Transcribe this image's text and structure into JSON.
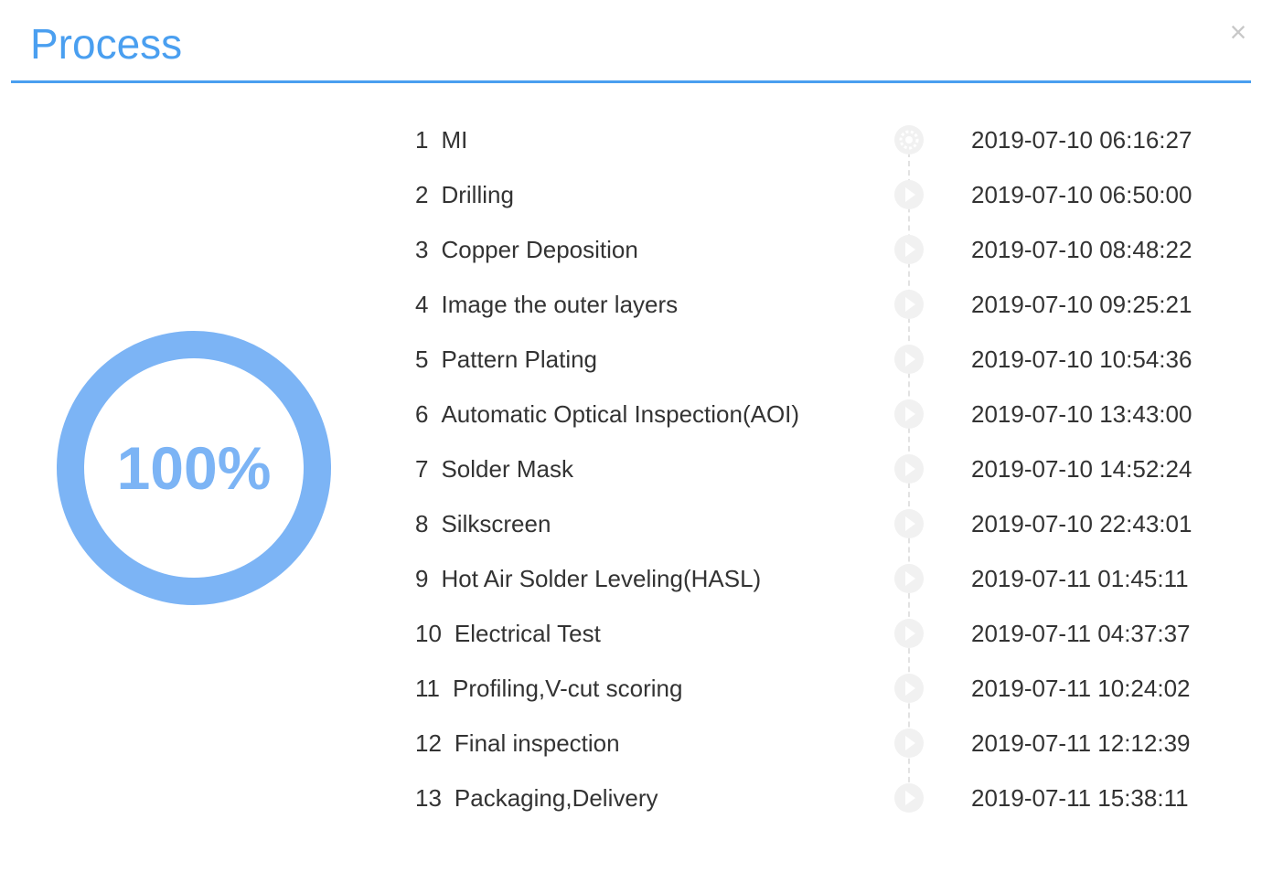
{
  "dialog": {
    "title": "Process",
    "close_label": "×"
  },
  "progress": {
    "label": "100%",
    "value_percent": 100,
    "ring_color": "#7cb4f5",
    "accent_color": "#4a9ff0"
  },
  "steps": [
    {
      "num": "1",
      "name": "MI",
      "time": "2019-07-10 06:16:27",
      "icon": "gear-icon"
    },
    {
      "num": "2",
      "name": "Drilling",
      "time": "2019-07-10 06:50:00",
      "icon": "play-icon"
    },
    {
      "num": "3",
      "name": "Copper Deposition",
      "time": "2019-07-10 08:48:22",
      "icon": "play-icon"
    },
    {
      "num": "4",
      "name": "Image the outer layers",
      "time": "2019-07-10 09:25:21",
      "icon": "play-icon"
    },
    {
      "num": "5",
      "name": "Pattern Plating",
      "time": "2019-07-10 10:54:36",
      "icon": "play-icon"
    },
    {
      "num": "6",
      "name": "Automatic Optical Inspection(AOI)",
      "time": "2019-07-10 13:43:00",
      "icon": "play-icon"
    },
    {
      "num": "7",
      "name": "Solder Mask",
      "time": "2019-07-10 14:52:24",
      "icon": "play-icon"
    },
    {
      "num": "8",
      "name": "Silkscreen",
      "time": "2019-07-10 22:43:01",
      "icon": "play-icon"
    },
    {
      "num": "9",
      "name": "Hot Air Solder Leveling(HASL)",
      "time": "2019-07-11 01:45:11",
      "icon": "play-icon"
    },
    {
      "num": "10",
      "name": "Electrical Test",
      "time": "2019-07-11 04:37:37",
      "icon": "play-icon"
    },
    {
      "num": "11",
      "name": "Profiling,V-cut scoring",
      "time": "2019-07-11 10:24:02",
      "icon": "play-icon"
    },
    {
      "num": "12",
      "name": "Final inspection",
      "time": "2019-07-11 12:12:39",
      "icon": "play-icon"
    },
    {
      "num": "13",
      "name": "Packaging,Delivery",
      "time": "2019-07-11 15:38:11",
      "icon": "play-icon"
    }
  ]
}
